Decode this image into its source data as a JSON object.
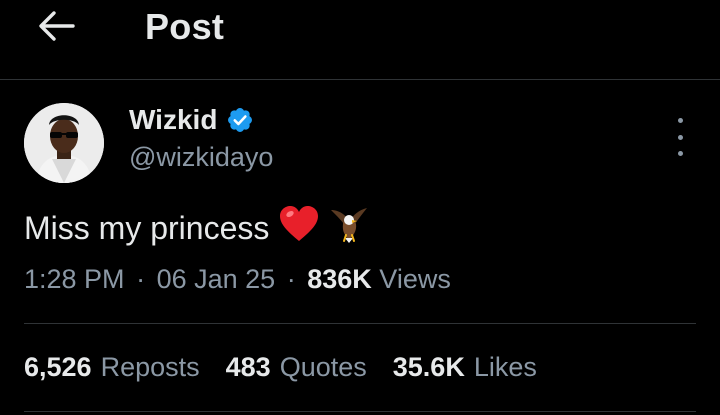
{
  "header": {
    "title": "Post"
  },
  "author": {
    "name": "Wizkid",
    "handle": "@wizkidayo",
    "verified_color": "#1d9bf0"
  },
  "post": {
    "text": "Miss my princess",
    "emojis": [
      "heart-emoji",
      "eagle-emoji"
    ]
  },
  "meta": {
    "time": "1:28 PM",
    "date": "06 Jan 25",
    "views_count": "836K",
    "views_label": "Views",
    "separator": "·"
  },
  "stats": [
    {
      "count": "6,526",
      "label": "Reposts"
    },
    {
      "count": "483",
      "label": "Quotes"
    },
    {
      "count": "35.6K",
      "label": "Likes"
    }
  ],
  "colors": {
    "background": "#000000",
    "text": "#e7e9ea",
    "secondary": "#8b98a5",
    "border": "#2f3336",
    "accent": "#1d9bf0"
  }
}
